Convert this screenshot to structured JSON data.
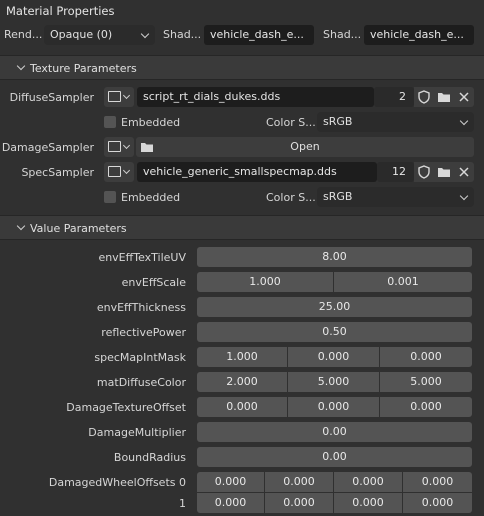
{
  "panel": {
    "title": "Material Properties"
  },
  "header_row": {
    "render_label": "Rend...",
    "render_value": "Opaque (0)",
    "shader1_label": "Shad...",
    "shader1_value": "vehicle_dash_e...",
    "shader2_label": "Shad...",
    "shader2_value": "vehicle_dash_e..."
  },
  "texture_params": {
    "title": "Texture Parameters",
    "diffuse": {
      "label": "DiffuseSampler",
      "filename": "script_rt_dials_dukes.dds",
      "users": "2"
    },
    "diffuse_opts": {
      "embedded_label": "Embedded",
      "colorspace_label": "Color S...",
      "colorspace_value": "sRGB"
    },
    "damage": {
      "label": "DamageSampler",
      "open_label": "Open"
    },
    "spec": {
      "label": "SpecSampler",
      "filename": "vehicle_generic_smallspecmap.dds",
      "users": "12"
    },
    "spec_opts": {
      "embedded_label": "Embedded",
      "colorspace_label": "Color S...",
      "colorspace_value": "sRGB"
    }
  },
  "value_params": {
    "title": "Value Parameters",
    "rows": [
      {
        "label": "envEffTexTileUV",
        "values": [
          "8.00"
        ]
      },
      {
        "label": "envEffScale",
        "values": [
          "1.000",
          "0.001"
        ]
      },
      {
        "label": "envEffThickness",
        "values": [
          "25.00"
        ]
      },
      {
        "label": "reflectivePower",
        "values": [
          "0.50"
        ]
      },
      {
        "label": "specMapIntMask",
        "values": [
          "1.000",
          "0.000",
          "0.000"
        ]
      },
      {
        "label": "matDiffuseColor",
        "values": [
          "2.000",
          "5.000",
          "5.000"
        ]
      },
      {
        "label": "DamageTextureOffset",
        "values": [
          "0.000",
          "0.000",
          "0.000"
        ]
      },
      {
        "label": "DamageMultiplier",
        "values": [
          "0.00"
        ]
      },
      {
        "label": "BoundRadius",
        "values": [
          "0.00"
        ]
      },
      {
        "label": "DamagedWheelOffsets 0",
        "values": [
          "0.000",
          "0.000",
          "0.000",
          "0.000"
        ]
      },
      {
        "label": "1",
        "values": [
          "0.000",
          "0.000",
          "0.000",
          "0.000"
        ]
      }
    ]
  }
}
